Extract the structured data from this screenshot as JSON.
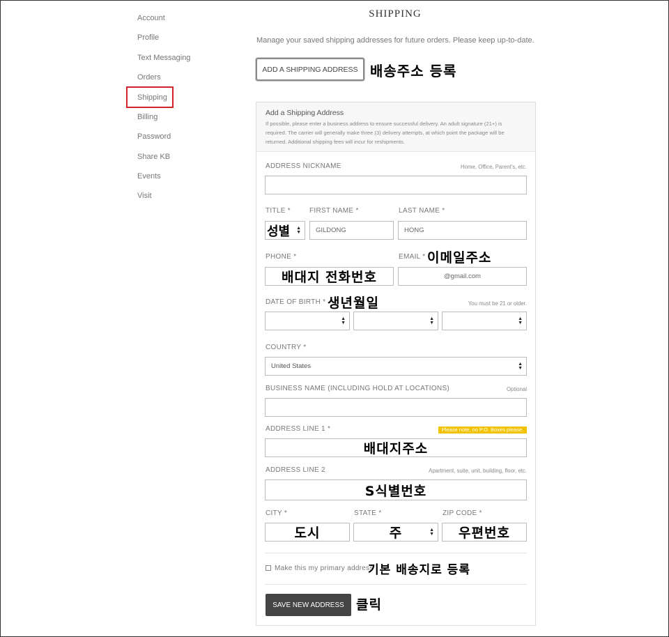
{
  "sidebar": {
    "items": [
      {
        "label": "Account"
      },
      {
        "label": "Profile"
      },
      {
        "label": "Text Messaging"
      },
      {
        "label": "Orders"
      },
      {
        "label": "Shipping"
      },
      {
        "label": "Billing"
      },
      {
        "label": "Password"
      },
      {
        "label": "Share KB"
      },
      {
        "label": "Events"
      },
      {
        "label": "Visit"
      }
    ],
    "selected": "Shipping"
  },
  "header": {
    "title": "SHIPPING",
    "intro": "Manage your saved shipping addresses for future orders. Please keep up-to-date.",
    "add_button": "ADD A SHIPPING ADDRESS"
  },
  "annotations": {
    "add_address": "배송주소 등록",
    "title": "성별",
    "email": "이메일주소",
    "phone": "배대지 전화번호",
    "dob": "생년월일",
    "address1": "배대지주소",
    "address2": "S식별번호",
    "city": "도시",
    "state": "주",
    "zip": "우편번호",
    "primary": "기본 배송지로 등록",
    "save": "클릭"
  },
  "form": {
    "panel_title": "Add a Shipping Address",
    "panel_desc": "If possible, please enter a business address to ensure successful delivery. An adult signature (21+) is required. The carrier will generally make three (3) delivery attempts, at which point the package will be returned. Additional shipping fees will incur for reshipments.",
    "nickname": {
      "label": "ADDRESS NICKNAME",
      "hint": "Home, Office, Parent's, etc.",
      "value": ""
    },
    "title": {
      "label": "TITLE *"
    },
    "first_name": {
      "label": "FIRST NAME *",
      "value": "GILDONG"
    },
    "last_name": {
      "label": "LAST NAME *",
      "value": "HONG"
    },
    "phone": {
      "label": "PHONE *"
    },
    "email": {
      "label": "EMAIL *",
      "value": "@gmail.com"
    },
    "dob": {
      "label": "DATE OF BIRTH *",
      "hint": "You must be 21 or older."
    },
    "country": {
      "label": "COUNTRY *",
      "value": "United States"
    },
    "business": {
      "label": "BUSINESS NAME (INCLUDING HOLD AT LOCATIONS)",
      "hint": "Optional",
      "value": ""
    },
    "address1": {
      "label": "ADDRESS LINE 1 *",
      "hint": "Please note, no P.O. Boxes please."
    },
    "address2": {
      "label": "ADDRESS LINE 2",
      "hint": "Apartment, suite, unit, building, floor, etc."
    },
    "city": {
      "label": "CITY *"
    },
    "state": {
      "label": "STATE *"
    },
    "zip": {
      "label": "ZIP CODE *"
    },
    "primary_label": "Make this my primary address",
    "save_button": "SAVE NEW ADDRESS"
  },
  "colors": {
    "highlight": "#d2232a",
    "note": "#f2c200",
    "button_dark": "#444444"
  }
}
